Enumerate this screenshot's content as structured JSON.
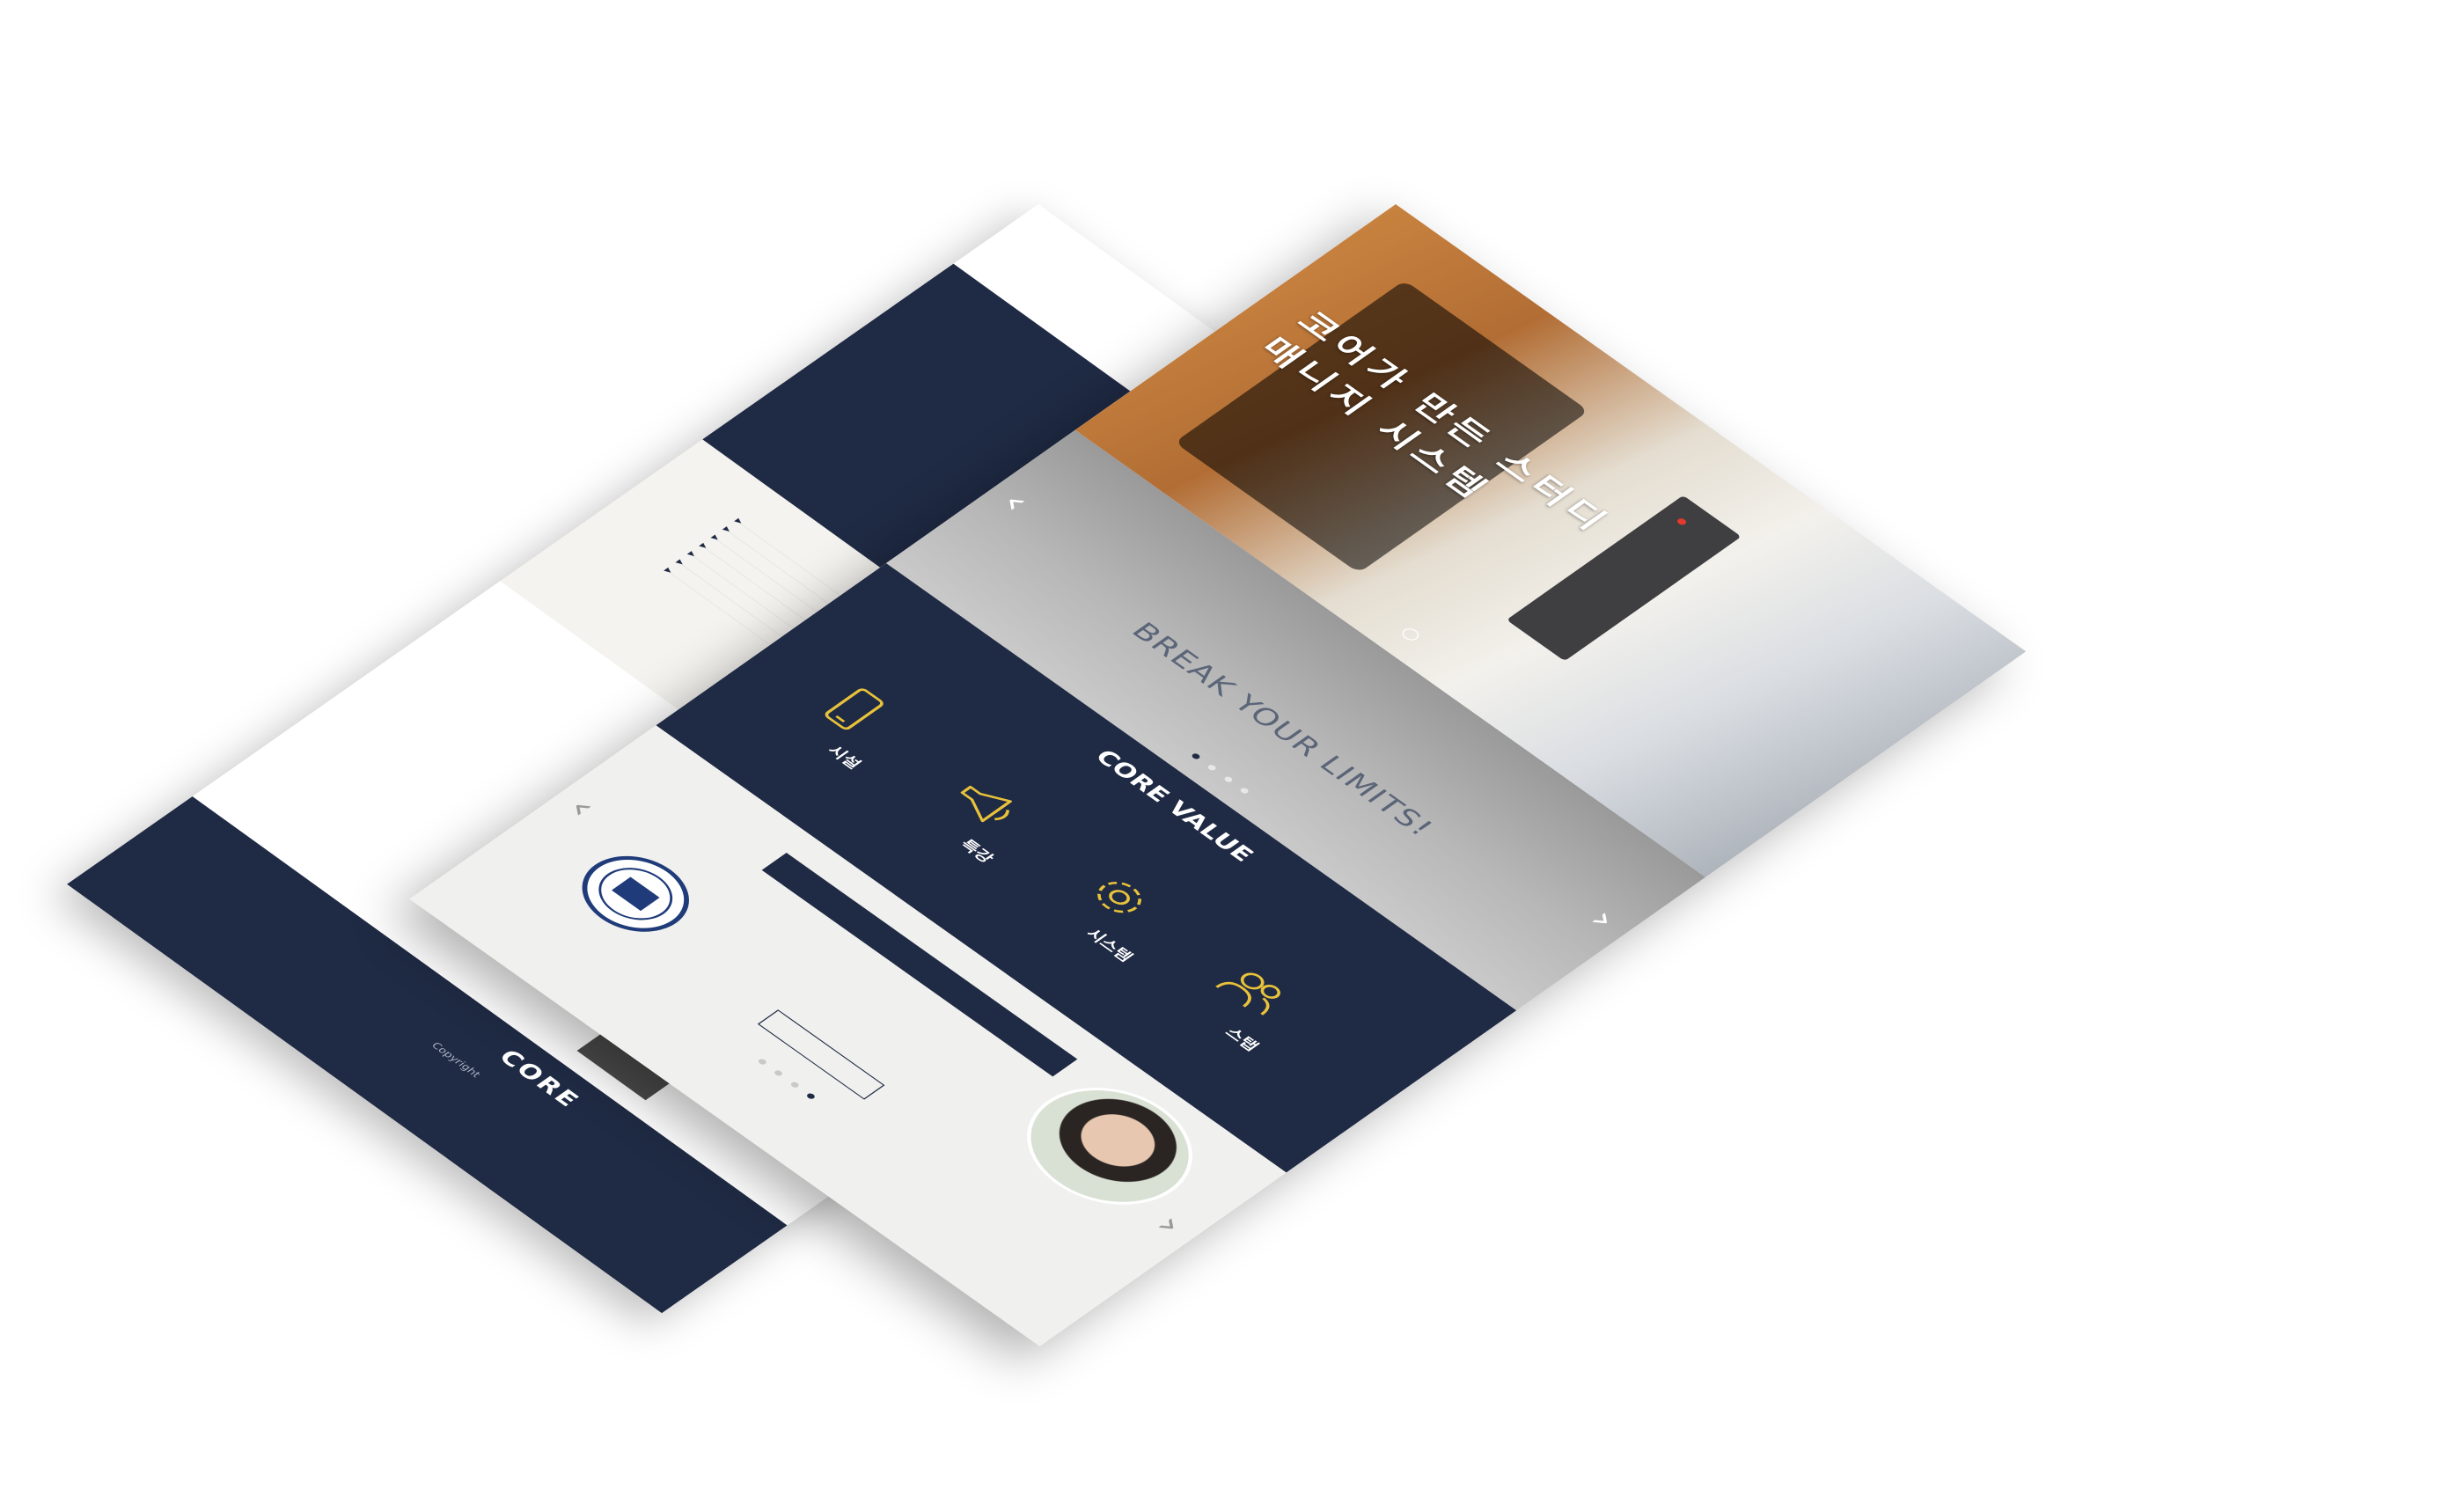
{
  "back_page": {
    "photo_caption": "",
    "list_items": [
      "",
      "",
      "",
      "",
      "",
      "",
      ""
    ],
    "footer": {
      "logo": "CORE",
      "lines": [
        "",
        "",
        "",
        "Copyright"
      ]
    }
  },
  "front_page": {
    "login": "",
    "hero": {
      "title": "코어가 만든 스터디\n매니지 시스템"
    },
    "break": {
      "title": "BREAK YOUR LIMITS!",
      "subtitle": ""
    },
    "core_value": {
      "title": "CORE VALUE",
      "description": "",
      "features": [
        {
          "name": "시설",
          "icon": "phone-icon",
          "desc": ""
        },
        {
          "name": "특강",
          "icon": "megaphone-icon",
          "desc": ""
        },
        {
          "name": "시스템",
          "icon": "gear-icon",
          "desc": ""
        },
        {
          "name": "스탭",
          "icon": "people-icon",
          "desc": ""
        }
      ]
    },
    "testimonial": {
      "headline": "",
      "quote": "",
      "sub": "",
      "button": "",
      "caption": ""
    }
  },
  "colors": {
    "navy": "#1f2a44",
    "accent_yellow": "#e8c23a",
    "background": "#ffffff"
  }
}
